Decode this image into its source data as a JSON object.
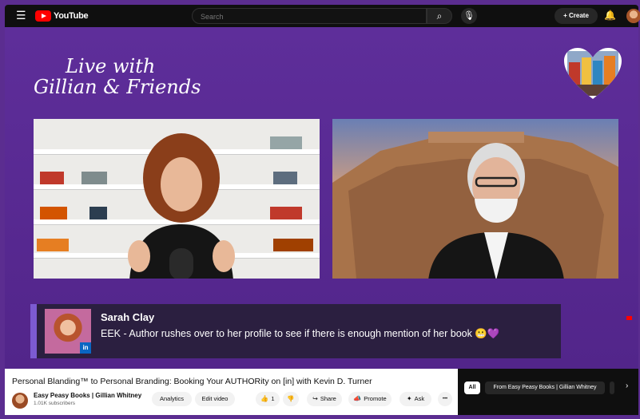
{
  "topbar": {
    "logo_text": "YouTube",
    "search_placeholder": "Search",
    "create_label": "Create"
  },
  "video": {
    "show_title_line1": "Live with",
    "show_title_line2": "Gillian & Friends",
    "lower_third": {
      "name": "Sarah Clay",
      "message": "EEK - Author rushes over to her profile to see if there is enough mention of her book 😬💜",
      "badge": "in"
    }
  },
  "info": {
    "title": "Personal Blanding™ to Personal Branding: Booking Your AUTHORity on [in] with Kevin D. Turner",
    "channel_name": "Easy Peasy Books | Gillian Whitney",
    "subscribers": "1.01K subscribers",
    "analytics_label": "Analytics",
    "edit_label": "Edit video",
    "likes": "1",
    "share_label": "Share",
    "promote_label": "Promote",
    "ask_label": "Ask",
    "more_label": "•••"
  },
  "related": {
    "chips": [
      "All",
      "From Easy Peasy Books | Gillian Whitney"
    ]
  },
  "colors": {
    "accent_purple": "#5b2d90",
    "youtube_red": "#ff0000",
    "linkedin_blue": "#0a66c2"
  }
}
